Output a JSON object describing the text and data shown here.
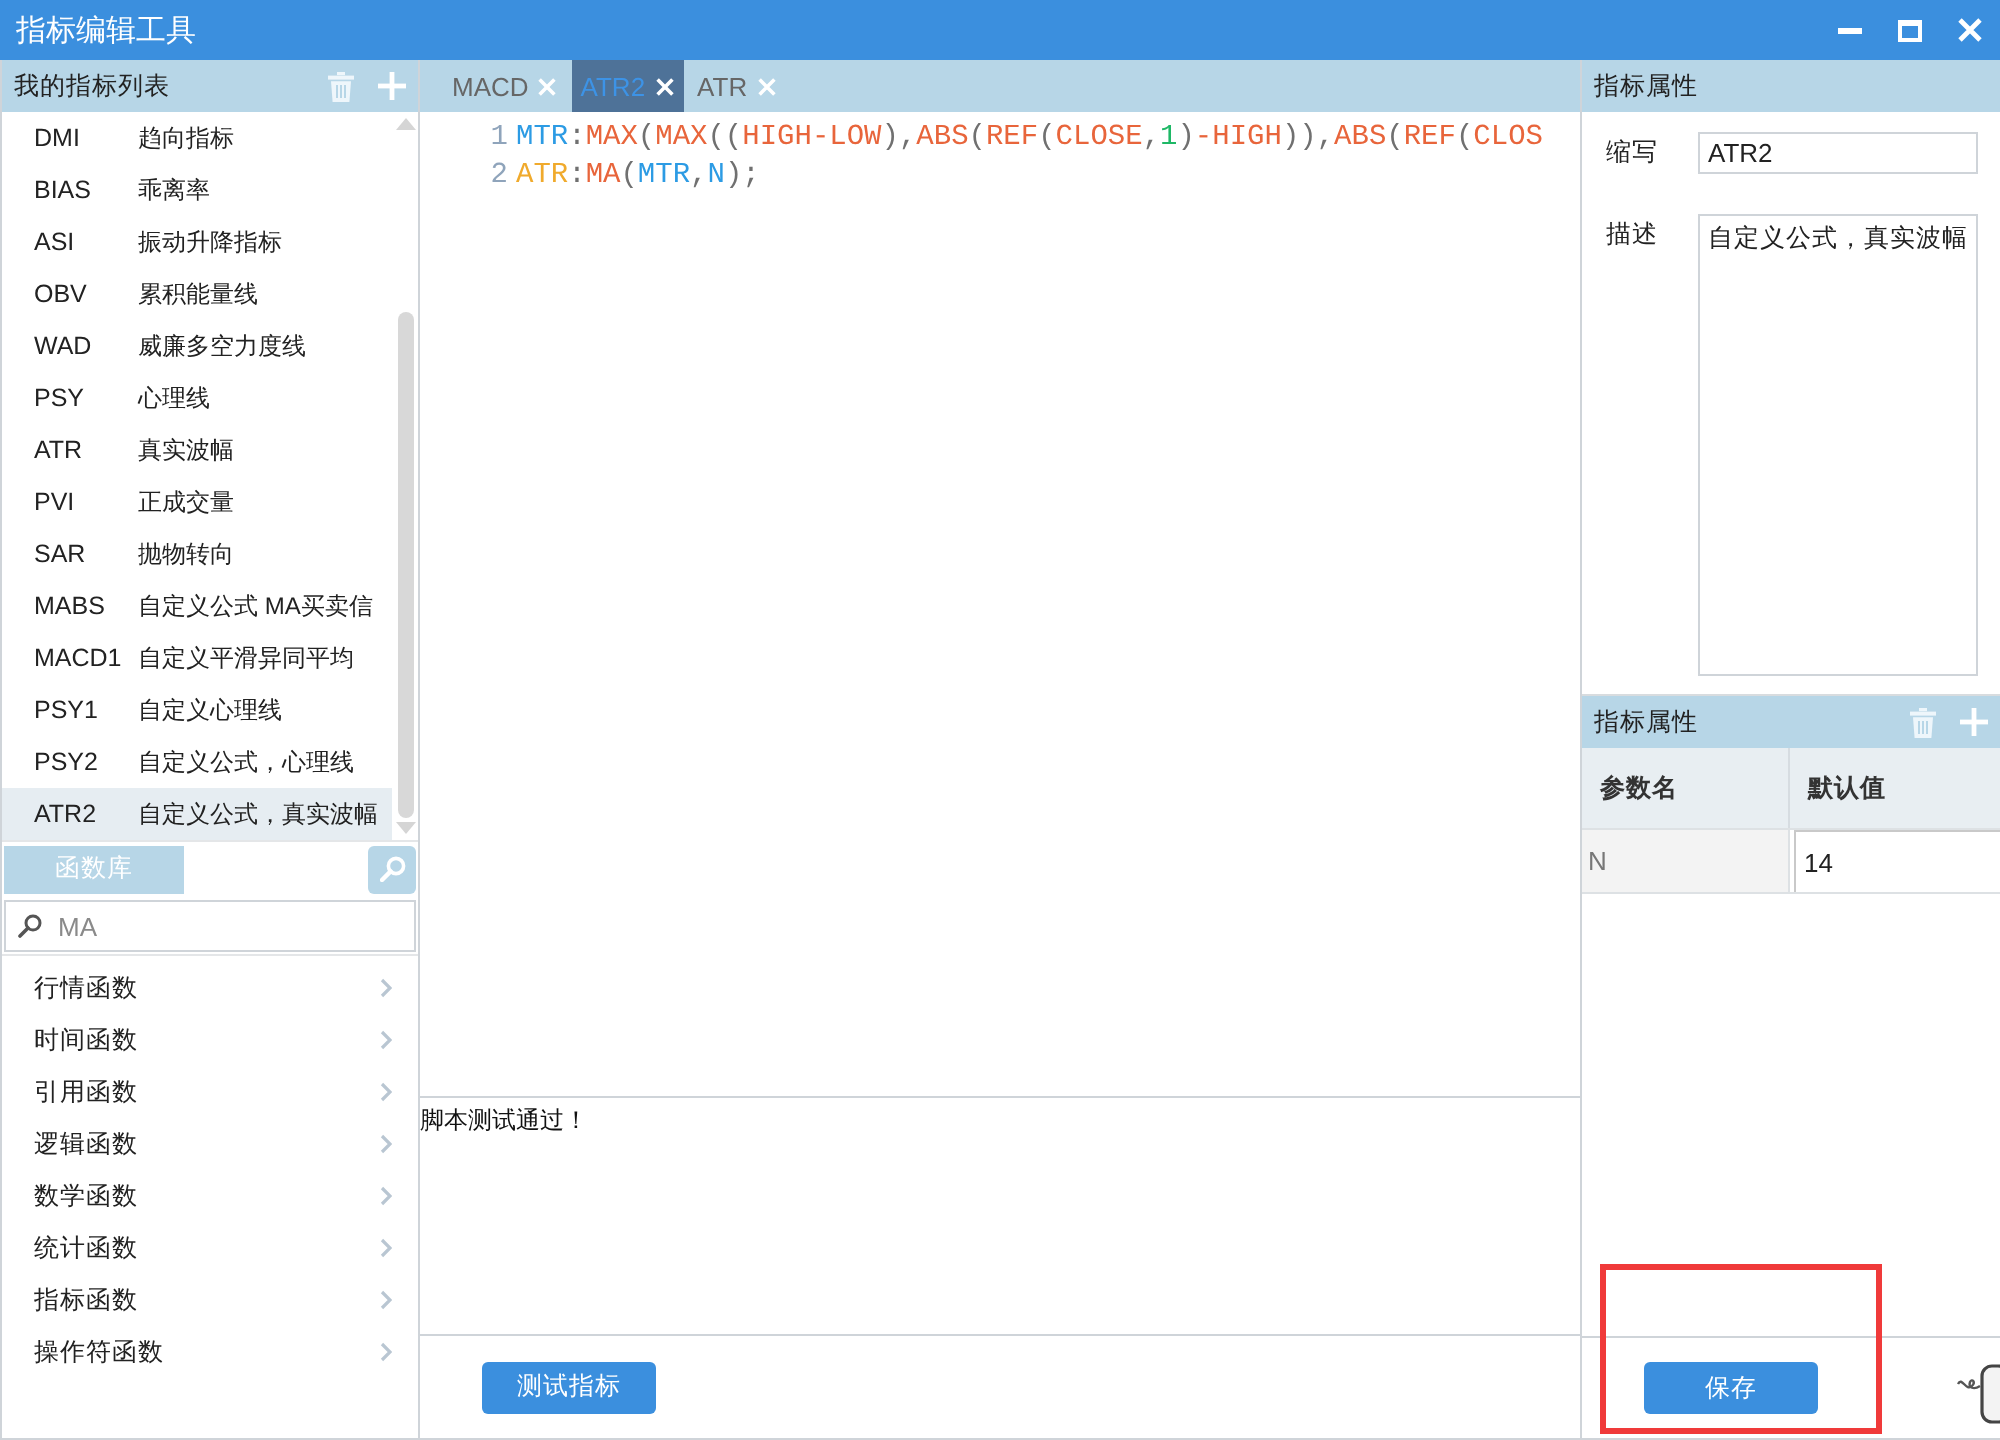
{
  "window": {
    "title": "指标编辑工具"
  },
  "indicator_list": {
    "title": "我的指标列表",
    "items": [
      {
        "code": "DMI",
        "name": "趋向指标",
        "selected": false
      },
      {
        "code": "BIAS",
        "name": "乖离率",
        "selected": false
      },
      {
        "code": "ASI",
        "name": "振动升降指标",
        "selected": false
      },
      {
        "code": "OBV",
        "name": "累积能量线",
        "selected": false
      },
      {
        "code": "WAD",
        "name": "威廉多空力度线",
        "selected": false
      },
      {
        "code": "PSY",
        "name": "心理线",
        "selected": false
      },
      {
        "code": "ATR",
        "name": "真实波幅",
        "selected": false
      },
      {
        "code": "PVI",
        "name": "正成交量",
        "selected": false
      },
      {
        "code": "SAR",
        "name": "抛物转向",
        "selected": false
      },
      {
        "code": "MABS",
        "name": "自定义公式 MA买卖信",
        "selected": false
      },
      {
        "code": "MACD1",
        "name": "自定义平滑异同平均",
        "selected": false
      },
      {
        "code": "PSY1",
        "name": "自定义心理线",
        "selected": false
      },
      {
        "code": "PSY2",
        "name": "自定义公式，心理线",
        "selected": false
      },
      {
        "code": "ATR2",
        "name": "自定义公式，真实波幅",
        "selected": true
      }
    ]
  },
  "function_library": {
    "tab": "函数库",
    "search": {
      "placeholder": "MA"
    },
    "categories": [
      "行情函数",
      "时间函数",
      "引用函数",
      "逻辑函数",
      "数学函数",
      "统计函数",
      "指标函数",
      "操作符函数"
    ]
  },
  "editor": {
    "tabs": [
      {
        "label": "MACD",
        "selected": false
      },
      {
        "label": "ATR2",
        "selected": true
      },
      {
        "label": "ATR",
        "selected": false
      }
    ],
    "lines": [
      {
        "number": "1",
        "tokens": [
          {
            "text": "MTR",
            "kind": "variable"
          },
          {
            "text": ":",
            "kind": "punct"
          },
          {
            "text": "MAX",
            "kind": "keyword"
          },
          {
            "text": "(",
            "kind": "punct"
          },
          {
            "text": "MAX",
            "kind": "keyword"
          },
          {
            "text": "((",
            "kind": "punct"
          },
          {
            "text": "HIGH-LOW",
            "kind": "keyword"
          },
          {
            "text": "),",
            "kind": "punct"
          },
          {
            "text": "ABS",
            "kind": "keyword"
          },
          {
            "text": "(",
            "kind": "punct"
          },
          {
            "text": "REF",
            "kind": "keyword"
          },
          {
            "text": "(",
            "kind": "punct"
          },
          {
            "text": "CLOSE",
            "kind": "keyword"
          },
          {
            "text": ",",
            "kind": "punct"
          },
          {
            "text": "1",
            "kind": "number"
          },
          {
            "text": ")",
            "kind": "punct"
          },
          {
            "text": "-HIGH",
            "kind": "keyword"
          },
          {
            "text": ")),",
            "kind": "punct"
          },
          {
            "text": "ABS",
            "kind": "keyword"
          },
          {
            "text": "(",
            "kind": "punct"
          },
          {
            "text": "REF",
            "kind": "keyword"
          },
          {
            "text": "(",
            "kind": "punct"
          },
          {
            "text": "CLOS",
            "kind": "keyword"
          }
        ]
      },
      {
        "number": "2",
        "tokens": [
          {
            "text": "ATR",
            "kind": "output"
          },
          {
            "text": ":",
            "kind": "punct"
          },
          {
            "text": "MA",
            "kind": "keyword"
          },
          {
            "text": "(",
            "kind": "punct"
          },
          {
            "text": "MTR",
            "kind": "variable"
          },
          {
            "text": ",",
            "kind": "punct"
          },
          {
            "text": "N",
            "kind": "variable"
          },
          {
            "text": ");",
            "kind": "punct"
          }
        ]
      }
    ],
    "output": "脚本测试通过！",
    "test_button": "测试指标"
  },
  "properties": {
    "title": "指标属性",
    "fields": [
      {
        "label": "缩写",
        "value": "ATR2",
        "kind": "input"
      },
      {
        "label": "描述",
        "value": "自定义公式，真实波幅",
        "kind": "textarea"
      }
    ]
  },
  "parameters": {
    "title": "指标属性",
    "columns": [
      "参数名",
      "默认值"
    ],
    "rows": [
      {
        "name": "N",
        "default": "14"
      }
    ]
  },
  "save_button": "保存"
}
